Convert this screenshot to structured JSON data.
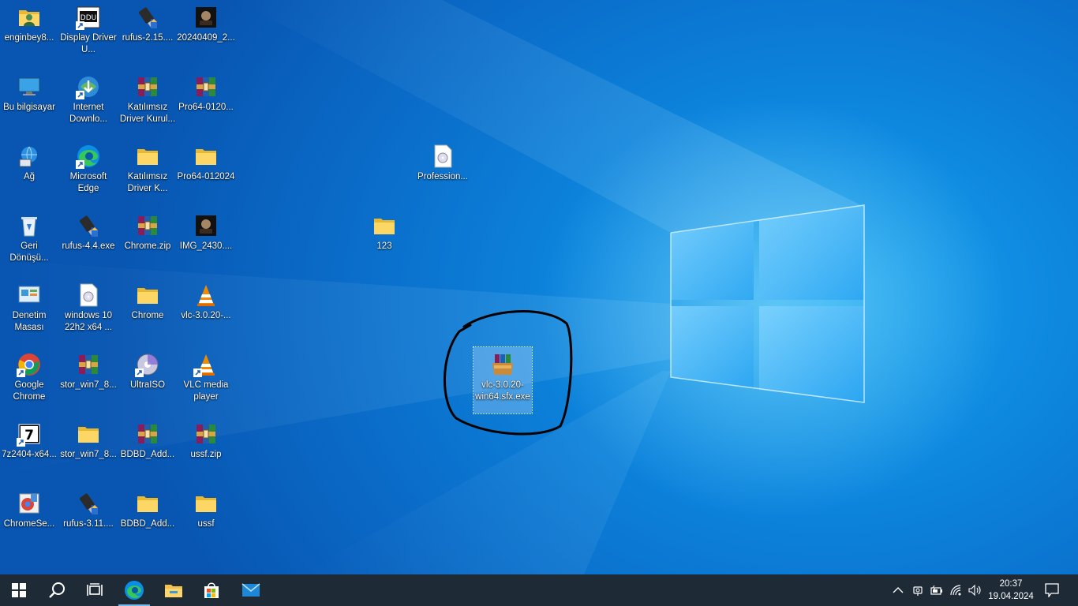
{
  "desktop": {
    "icons": [
      {
        "label": "enginbey8...",
        "icon": "user-folder-icon"
      },
      {
        "label": "Display Driver U...",
        "icon": "ddu-app-icon"
      },
      {
        "label": "rufus-2.15....",
        "icon": "usb-drive-icon"
      },
      {
        "label": "20240409_2...",
        "icon": "photo-thumbnail-icon"
      },
      {
        "label": "Bu bilgisayar",
        "icon": "this-pc-icon"
      },
      {
        "label": "Internet Downlo...",
        "icon": "internet-download-manager-icon"
      },
      {
        "label": "Katılımsız Driver Kurul...",
        "icon": "winrar-archive-icon"
      },
      {
        "label": "Pro64-0120...",
        "icon": "winrar-archive-icon"
      },
      {
        "label": "Ağ",
        "icon": "network-icon"
      },
      {
        "label": "Microsoft Edge",
        "icon": "edge-icon"
      },
      {
        "label": "Katılımsız Driver K...",
        "icon": "folder-icon"
      },
      {
        "label": "Pro64-012024",
        "icon": "folder-icon"
      },
      {
        "label": "Profession...",
        "icon": "disc-image-file-icon"
      },
      {
        "label": "Geri Dönüşü...",
        "icon": "recycle-bin-icon"
      },
      {
        "label": "rufus-4.4.exe",
        "icon": "usb-drive-icon"
      },
      {
        "label": "Chrome.zip",
        "icon": "winrar-archive-icon"
      },
      {
        "label": "IMG_2430....",
        "icon": "photo-thumbnail-icon"
      },
      {
        "label": "123",
        "icon": "folder-icon"
      },
      {
        "label": "Denetim Masası",
        "icon": "control-panel-icon"
      },
      {
        "label": "windows 10 22h2 x64 ...",
        "icon": "disc-image-file-icon"
      },
      {
        "label": "Chrome",
        "icon": "folder-icon"
      },
      {
        "label": "vlc-3.0.20-...",
        "icon": "vlc-icon"
      },
      {
        "label": "vlc-3.0.20-win64.sfx.exe",
        "icon": "winrar-sfx-icon"
      },
      {
        "label": "Google Chrome",
        "icon": "chrome-icon"
      },
      {
        "label": "stor_win7_8...",
        "icon": "winrar-archive-icon"
      },
      {
        "label": "UltraISO",
        "icon": "ultraiso-icon"
      },
      {
        "label": "VLC media player",
        "icon": "vlc-icon"
      },
      {
        "label": "7z2404-x64...",
        "icon": "seven-zip-icon"
      },
      {
        "label": "stor_win7_8...",
        "icon": "folder-icon"
      },
      {
        "label": "BDBD_Add...",
        "icon": "winrar-archive-icon"
      },
      {
        "label": "ussf.zip",
        "icon": "winrar-archive-icon"
      },
      {
        "label": "ChromeSe...",
        "icon": "chrome-setup-icon"
      },
      {
        "label": "rufus-3.11....",
        "icon": "usb-drive-icon"
      },
      {
        "label": "BDBD_Add...",
        "icon": "folder-icon"
      },
      {
        "label": "ussf",
        "icon": "folder-icon"
      }
    ]
  },
  "taskbar": {
    "buttons": [
      "start-icon",
      "search-icon",
      "task-view-icon",
      "edge-icon",
      "file-explorer-icon",
      "microsoft-store-icon",
      "mail-icon"
    ],
    "active": "edge-icon",
    "tray": [
      "show-hidden-icons-icon",
      "meet-now-icon",
      "battery-icon",
      "wifi-icon",
      "volume-icon"
    ],
    "time": "20:37",
    "date": "19.04.2024",
    "notification": "action-center-icon"
  },
  "colors": {
    "taskbar": "#1e2a36",
    "desktop": "#0d86de",
    "annotation": "#000000"
  }
}
